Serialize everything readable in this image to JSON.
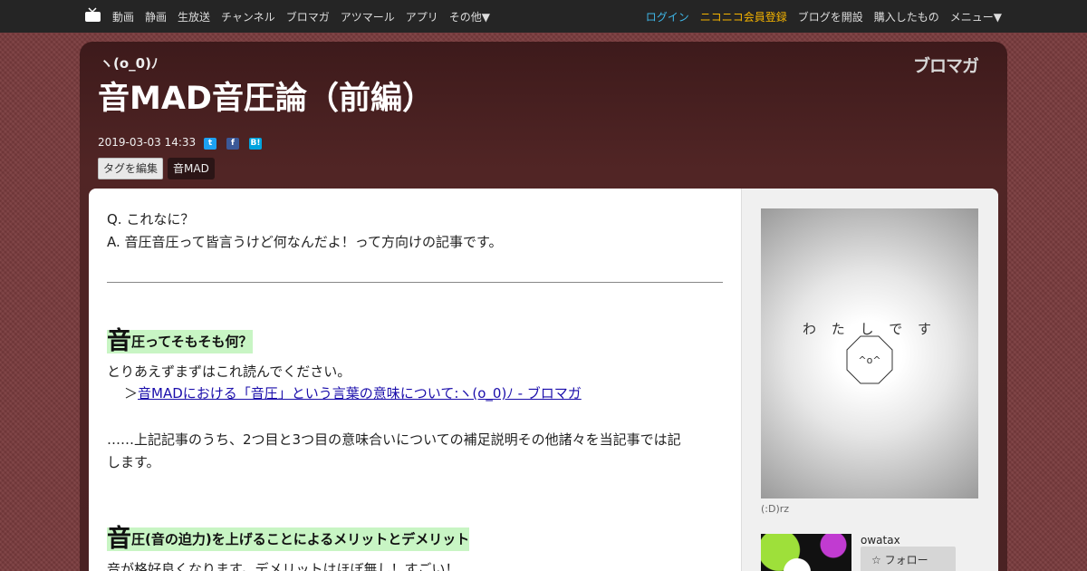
{
  "topnav": {
    "items": [
      "動画",
      "静画",
      "生放送",
      "チャンネル",
      "ブロマガ",
      "アツマール",
      "アプリ",
      "その他▼"
    ],
    "login": "ログイン",
    "register": "ニコニコ会員登録",
    "start_blog": "ブログを開設",
    "purchased": "購入したもの",
    "menu": "メニュー▼"
  },
  "header": {
    "author": "ヽ(o_0)ﾉ",
    "logo": "ブロマガ",
    "title": "音MAD音圧論（前編）",
    "date": "2019-03-03 14:33",
    "share_icons": [
      "twitter-icon",
      "facebook-icon",
      "hatena-bookmark-icon"
    ],
    "share_glyphs": [
      "t",
      "f",
      "B!"
    ],
    "edit_tags": "タグを編集",
    "tag": "音MAD"
  },
  "article": {
    "q_line": "Q. これなに？",
    "a_line": "A. 音圧音圧って皆言うけど何なんだよ！って方向けの記事です。",
    "h1_big": "音",
    "h1_rest": "圧ってそもそも何？",
    "p1": "とりあえずまずはこれ読んでください。",
    "link_prefix": "＞",
    "link_text": "音MADにおける「音圧」という言葉の意味について:ヽ(o_0)ﾉ - ブロマガ",
    "p2_line1": "……上記記事のうち、2つ目と3つ目の意味合いについての補足説明その他諸々を当記事では記",
    "p2_line2": "します。",
    "h2_big": "音",
    "h2_rest": "圧(音の迫力)を上げることによるメリットとデメリット",
    "p3": "音が格好良くなります。デメリットはほぼ無し！すごい！"
  },
  "sidebar": {
    "image_caption": "わ た し で す",
    "image_face": "^o^",
    "image_label": "(:D)rz",
    "author": "owatax",
    "follow_label": "フォロー"
  },
  "colors": {
    "accent_login": "#3fb7e8",
    "accent_register": "#f5b400",
    "heading_highlight": "#c8f5c4",
    "background": "#7a3c3e"
  }
}
